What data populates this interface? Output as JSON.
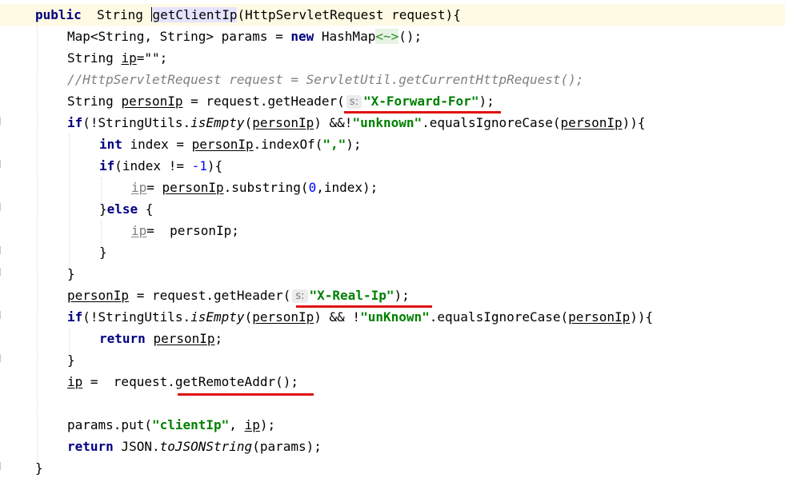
{
  "editor": {
    "lines": [
      {
        "id": "l1"
      },
      {
        "id": "l2"
      }
    ],
    "tokens": {
      "public": "public",
      "string_type": "String",
      "method_name": "getClientIp",
      "sig_rest": "(HttpServletRequest request){",
      "map_decl": "Map<String, String> params = ",
      "new": "new",
      "hashmap": " HashMap",
      "diamond": "<~>",
      "hashmap_end": "();",
      "string_ip": "String ",
      "ip": "ip",
      "ip_init": "=\"\";",
      "comment": "//HttpServletRequest request = ServletUtil.getCurrentHttpRequest();",
      "personIp": "personIp",
      "assign_getheader": " = request.getHeader(",
      "hint_s": "s:",
      "x_forward_for": "\"X-Forward-For\"",
      "close_semi": ");",
      "if": "if",
      "not_stringutils": "(!StringUtils.",
      "isEmpty": "isEmpty",
      "paren_open": "(",
      "amp_not1": ") &&!",
      "unknown1": "\"unknown\"",
      "equals_ic": ".equalsIgnoreCase(",
      "close_brace_open": ")){",
      "int": "int",
      "index_eq": " index = ",
      "indexof": ".indexOf(",
      "comma_str": "\",\"",
      "if_index": "(index != ",
      "neg_one": "-1",
      "brace_open_paren": "){",
      "ip_eq_sp": "= ",
      "substring": ".substring(",
      "zero": "0",
      "index_close": ",index);",
      "close_brace": "}",
      "else": "else",
      "open_brace": " {",
      "ip_eq2": "=  ",
      "semi": ";",
      "x_real_ip": "\"X-Real-Ip\"",
      "amp_not2": ") && !",
      "unknown2": "\"unKnown\"",
      "return": "return",
      "ip_eq3": " =  request.",
      "getremoteaddr": "getRemoteAddr();",
      "params_put": "params.put(",
      "clientip_str": "\"clientIp\"",
      "comma_sp": ", ",
      "json": " JSON.",
      "tojson": "toJSONString",
      "params_close": "(params);"
    }
  }
}
